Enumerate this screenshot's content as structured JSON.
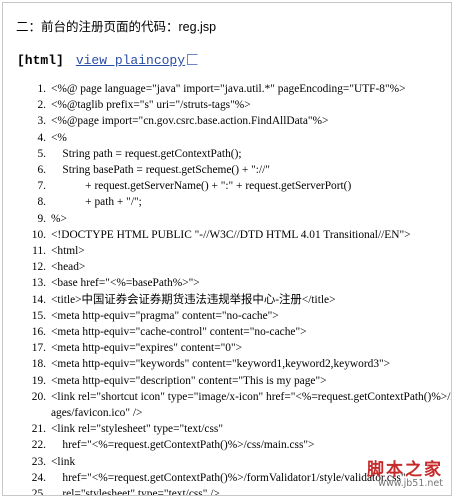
{
  "heading": "二：前台的注册页面的代码：reg.jsp",
  "toolbar": {
    "lang": "[html]",
    "view_label": "view plaincopy"
  },
  "code_lines": [
    {
      "n": "1.",
      "text": "<%@ page language=\"java\" import=\"java.util.*\" pageEncoding=\"UTF-8\"%>"
    },
    {
      "n": "2.",
      "text": "<%@taglib prefix=\"s\" uri=\"/struts-tags\"%>"
    },
    {
      "n": "3.",
      "text": "<%@page import=\"cn.gov.csrc.base.action.FindAllData\"%>"
    },
    {
      "n": "4.",
      "text": "<%"
    },
    {
      "n": "5.",
      "text": "    String path = request.getContextPath();"
    },
    {
      "n": "6.",
      "text": "    String basePath = request.getScheme() + \"://\""
    },
    {
      "n": "7.",
      "text": "            + request.getServerName() + \":\" + request.getServerPort()"
    },
    {
      "n": "8.",
      "text": "            + path + \"/\";"
    },
    {
      "n": "9.",
      "text": "%>"
    },
    {
      "n": "10.",
      "text": "<!DOCTYPE HTML PUBLIC \"-//W3C//DTD HTML 4.01 Transitional//EN\">"
    },
    {
      "n": "11.",
      "text": "<html>"
    },
    {
      "n": "12.",
      "text": "<head>"
    },
    {
      "n": "13.",
      "text": "<base href=\"<%=basePath%>\">"
    },
    {
      "n": "14.",
      "text": "<title>中国证券会证券期货违法违规举报中心-注册</title>"
    },
    {
      "n": "15.",
      "text": "<meta http-equiv=\"pragma\" content=\"no-cache\">"
    },
    {
      "n": "16.",
      "text": "<meta http-equiv=\"cache-control\" content=\"no-cache\">"
    },
    {
      "n": "17.",
      "text": "<meta http-equiv=\"expires\" content=\"0\">"
    },
    {
      "n": "18.",
      "text": "<meta http-equiv=\"keywords\" content=\"keyword1,keyword2,keyword3\">"
    },
    {
      "n": "19.",
      "text": "<meta http-equiv=\"description\" content=\"This is my page\">"
    },
    {
      "n": "20.",
      "text": "<link rel=\"shortcut icon\" type=\"image/x-icon\" href=\"<%=request.getContextPath()%>/im",
      "cont": "ages/favicon.ico\" />"
    },
    {
      "n": "21.",
      "text": "<link rel=\"stylesheet\" type=\"text/css\""
    },
    {
      "n": "22.",
      "text": "    href=\"<%=request.getContextPath()%>/css/main.css\">"
    },
    {
      "n": "23.",
      "text": "<link"
    },
    {
      "n": "24.",
      "text": "    href=\"<%=request.getContextPath()%>/formValidator1/style/validator.css\""
    },
    {
      "n": "25.",
      "text": "    rel=\"stylesheet\" type=\"text/css\" />"
    },
    {
      "n": "26.",
      "text": "<style type=\"text/css\">"
    }
  ],
  "watermark": {
    "title": "脚本之家",
    "url": "www.jb51.net"
  }
}
